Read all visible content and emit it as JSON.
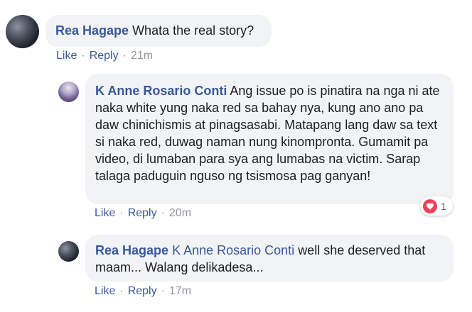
{
  "comments": [
    {
      "author": "Rea Hagape",
      "mention": "",
      "text": "Whata the real story?",
      "actions": {
        "like": "Like",
        "reply": "Reply",
        "time": "21m"
      }
    },
    {
      "author": "K Anne Rosario Conti",
      "mention": "",
      "text": "Ang issue po is pinatira na nga ni ate naka white yung naka red sa bahay nya, kung ano ano pa daw chinichismis at pinagsasabi. Matapang lang daw sa text si naka red, duwag naman nung kinompronta. Gumamit pa video, di lumaban para sya ang lumabas na victim. Sarap talaga paduguin nguso ng tsismosa pag ganyan!",
      "actions": {
        "like": "Like",
        "reply": "Reply",
        "time": "20m"
      },
      "reactions": {
        "icon": "heart-icon",
        "count": "1"
      }
    },
    {
      "author": "Rea Hagape",
      "mention": "K Anne Rosario Conti",
      "text": "well she deserved that maam... Walang delikadesa...",
      "actions": {
        "like": "Like",
        "reply": "Reply",
        "time": "17m"
      }
    }
  ],
  "colors": {
    "link": "#385898",
    "bubble": "#f2f3f5",
    "meta": "#90949c",
    "heart": "#f33e58"
  },
  "separator": "·"
}
